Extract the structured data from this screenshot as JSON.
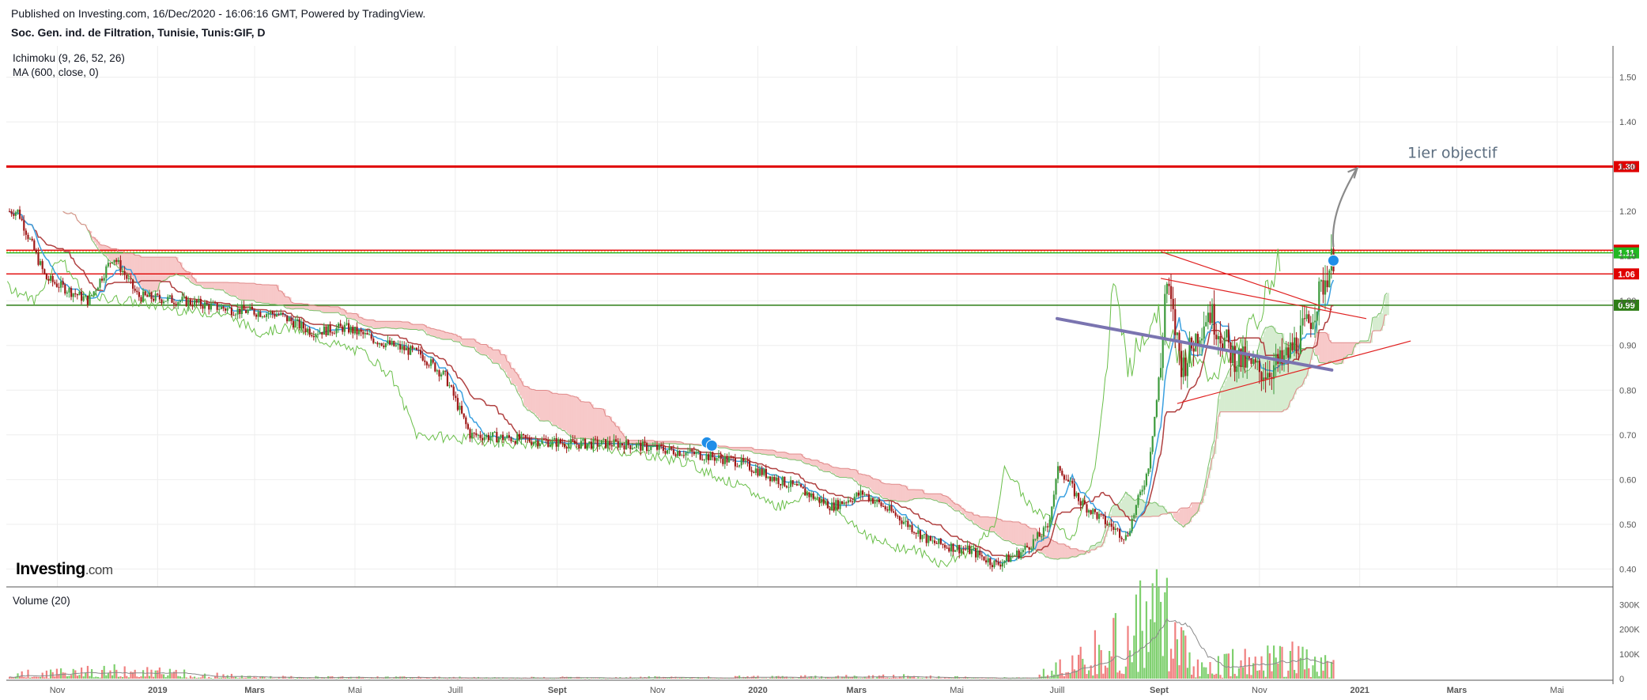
{
  "header": {
    "published": "Published on Investing.com, 16/Dec/2020 - 16:06:16 GMT, Powered by TradingView.",
    "symbol": "Soc. Gen. ind. de Filtration, Tunisie, Tunis:GIF, D"
  },
  "indicators": {
    "ichimoku": "Ichimoku (9, 26, 52, 26)",
    "ma": "MA (600, close, 0)",
    "volume": "Volume (20)"
  },
  "logo": {
    "brand": "Investing",
    "suffix": ".com"
  },
  "annotation": "1ier objectif",
  "colors": {
    "up": "#3c9a3c",
    "down": "#a01818",
    "tenkan": "#3aa0e0",
    "kijun": "#b04040",
    "chikou": "#6abf4a",
    "cloud_red": "#f7c9c9",
    "cloud_green": "#d6ecd0",
    "resistance": "#e00000",
    "support": "#2e7d16",
    "trend_blue": "#7a74b0",
    "ma": "#8a8a8a"
  },
  "chart_data": {
    "type": "candlestick",
    "x_tick_labels": [
      "Nov",
      "2019",
      "Mars",
      "Mai",
      "Juill",
      "Sept",
      "Nov",
      "2020",
      "Mars",
      "Mai",
      "Juill",
      "Sept",
      "Nov",
      "2021",
      "Mars",
      "Mai"
    ],
    "y_tick_labels": [
      "1.50",
      "1.40",
      "1.30",
      "1.20",
      "1.10",
      "1.00",
      "0.90",
      "0.80",
      "0.70",
      "0.60",
      "0.50",
      "0.40"
    ],
    "ylim": [
      0.36,
      1.57
    ],
    "volume_tick_labels": [
      "300K",
      "200K",
      "100K",
      "0"
    ],
    "volume_ylim": [
      0,
      330000
    ],
    "horizontal_levels": [
      {
        "label": "1.30",
        "value": 1.3,
        "color": "#e00000"
      },
      {
        "label": "1.11",
        "value": 1.113,
        "color": "#e00000"
      },
      {
        "label": "1.11",
        "value": 1.107,
        "color": "#22b822"
      },
      {
        "label": "1.06",
        "value": 1.06,
        "color": "#e00000"
      },
      {
        "label": "0.99",
        "value": 0.99,
        "color": "#2e7d16"
      }
    ],
    "price_path": [
      [
        "2018-10-08",
        1.2
      ],
      [
        "2018-10-25",
        1.05
      ],
      [
        "2018-11-20",
        1.0
      ],
      [
        "2018-12-05",
        1.1
      ],
      [
        "2018-12-20",
        1.01
      ],
      [
        "2019-01-15",
        1.0
      ],
      [
        "2019-02-15",
        0.98
      ],
      [
        "2019-03-15",
        0.97
      ],
      [
        "2019-04-05",
        0.93
      ],
      [
        "2019-04-25",
        0.94
      ],
      [
        "2019-05-15",
        0.91
      ],
      [
        "2019-06-10",
        0.88
      ],
      [
        "2019-06-25",
        0.83
      ],
      [
        "2019-07-10",
        0.7
      ],
      [
        "2019-08-10",
        0.69
      ],
      [
        "2019-09-10",
        0.68
      ],
      [
        "2019-10-10",
        0.68
      ],
      [
        "2019-11-20",
        0.66
      ],
      [
        "2019-12-20",
        0.64
      ],
      [
        "2020-01-25",
        0.58
      ],
      [
        "2020-02-15",
        0.54
      ],
      [
        "2020-03-05",
        0.57
      ],
      [
        "2020-03-25",
        0.52
      ],
      [
        "2020-04-15",
        0.46
      ],
      [
        "2020-05-10",
        0.44
      ],
      [
        "2020-05-25",
        0.41
      ],
      [
        "2020-06-10",
        0.44
      ],
      [
        "2020-06-25",
        0.49
      ],
      [
        "2020-07-02",
        0.63
      ],
      [
        "2020-07-15",
        0.55
      ],
      [
        "2020-08-01",
        0.5
      ],
      [
        "2020-08-12",
        0.47
      ],
      [
        "2020-08-25",
        0.62
      ],
      [
        "2020-09-02",
        0.85
      ],
      [
        "2020-09-05",
        1.05
      ],
      [
        "2020-09-15",
        0.85
      ],
      [
        "2020-10-01",
        0.98
      ],
      [
        "2020-10-15",
        0.88
      ],
      [
        "2020-11-01",
        0.84
      ],
      [
        "2020-11-15",
        0.86
      ],
      [
        "2020-12-01",
        0.95
      ],
      [
        "2020-12-10",
        1.04
      ],
      [
        "2020-12-16",
        1.1
      ]
    ],
    "volume_path": [
      [
        "2018-10-15",
        25000
      ],
      [
        "2018-12-10",
        40000
      ],
      [
        "2019-03-01",
        8000
      ],
      [
        "2019-08-01",
        5000
      ],
      [
        "2020-01-15",
        9000
      ],
      [
        "2020-03-15",
        14000
      ],
      [
        "2020-06-15",
        3000
      ],
      [
        "2020-07-05",
        80000
      ],
      [
        "2020-09-02",
        320000
      ],
      [
        "2020-09-25",
        60000
      ],
      [
        "2020-11-15",
        110000
      ],
      [
        "2020-12-16",
        60000
      ]
    ]
  }
}
